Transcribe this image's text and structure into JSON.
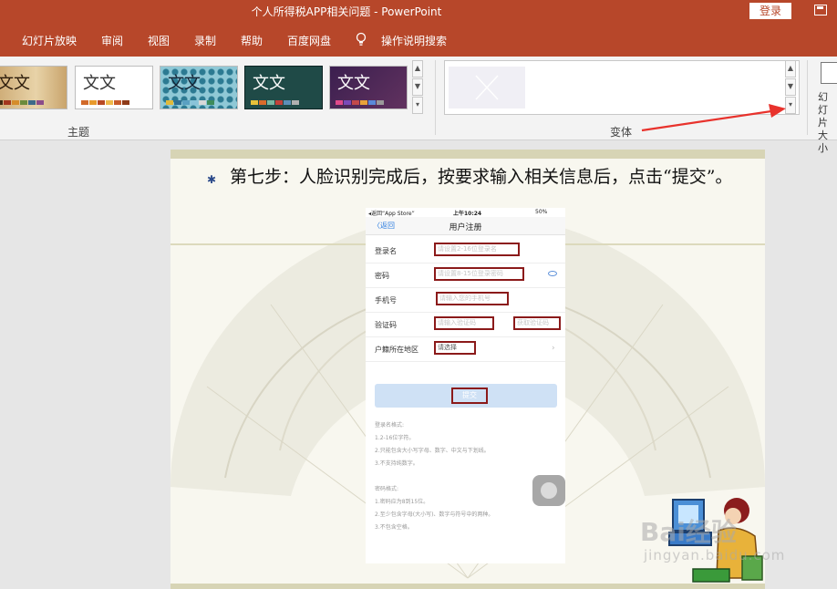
{
  "window": {
    "title": "个人所得税APP相关问题  -  PowerPoint",
    "login_label": "登录"
  },
  "menu": {
    "items": [
      "幻灯片放映",
      "审阅",
      "视图",
      "录制",
      "帮助",
      "百度网盘"
    ],
    "tell_me": "操作说明搜索"
  },
  "ribbon": {
    "themes": [
      {
        "text": "文文",
        "style": "wood"
      },
      {
        "text": "文文",
        "style": "white"
      },
      {
        "text": "文文",
        "style": "blue-pattern"
      },
      {
        "text": "文文",
        "style": "dark-teal"
      },
      {
        "text": "文文",
        "style": "purple"
      }
    ],
    "themes_group_label": "主题",
    "variants_group_label": "变体",
    "slide_size_label": "幻灯片大小"
  },
  "slide": {
    "step_text": "第七步：人脸识别完成后，按要求输入相关信息后，点击“提交”。"
  },
  "phone": {
    "status_left": "◂返回“App Store”",
    "status_time": "上午10:24",
    "status_battery": "50%",
    "back_label": "〈返回",
    "screen_title": "用户注册",
    "fields": [
      {
        "label": "登录名",
        "placeholder": "请设置2-16位登录名"
      },
      {
        "label": "密码",
        "placeholder": "请设置8-15位登录密码"
      },
      {
        "label": "手机号",
        "placeholder": "请输入您的手机号"
      },
      {
        "label": "验证码",
        "placeholder": "请输入验证码",
        "action": "获取验证码"
      },
      {
        "label": "户籍所在地区",
        "placeholder": "请选择"
      }
    ],
    "submit_label": "提交",
    "notes": [
      "登录名格式:",
      "1.2-16位字符。",
      "2.只能包含大小写字母、数字、中文与下划线。",
      "3.不支持纯数字。",
      "",
      "密码格式:",
      "1.密码应为8到15位。",
      "2.至少包含字母(大小写)、数字与符号中的两种。",
      "3.不包含空格。"
    ]
  },
  "watermark": {
    "brand": "Bai经验",
    "domain": "jingyan.baidu.com"
  },
  "colors": {
    "accent": "#b7472a",
    "highlight_box": "#8b1a1a",
    "link": "#2b7ce0"
  }
}
